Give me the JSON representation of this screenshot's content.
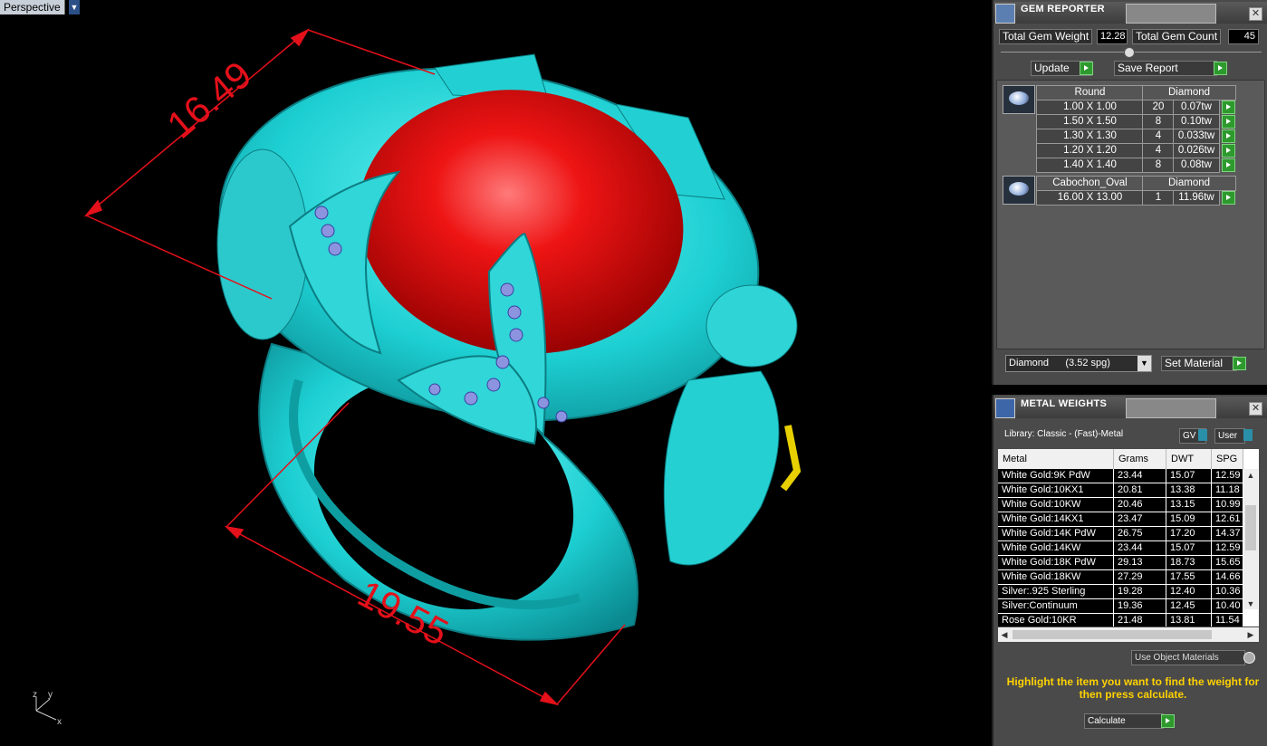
{
  "viewport": {
    "label": "Perspective",
    "dimensions": [
      "16.49",
      "19.55"
    ],
    "axis_labels": {
      "z": "z",
      "y": "y",
      "x": "x"
    }
  },
  "gem_reporter": {
    "title": "GEM REPORTER",
    "total_weight_label": "Total Gem Weight",
    "total_weight_value": "12.28",
    "total_count_label": "Total Gem Count",
    "total_count_value": "45",
    "update_label": "Update",
    "save_report_label": "Save Report",
    "groups": [
      {
        "shape": "Round",
        "material": "Diamond",
        "rows": [
          {
            "size": "1.00 X 1.00",
            "count": "20",
            "weight": "0.07tw"
          },
          {
            "size": "1.50 X 1.50",
            "count": "8",
            "weight": "0.10tw"
          },
          {
            "size": "1.30 X 1.30",
            "count": "4",
            "weight": "0.033tw"
          },
          {
            "size": "1.20 X 1.20",
            "count": "4",
            "weight": "0.026tw"
          },
          {
            "size": "1.40 X 1.40",
            "count": "8",
            "weight": "0.08tw"
          }
        ]
      },
      {
        "shape": "Cabochon_Oval",
        "material": "Diamond",
        "rows": [
          {
            "size": "16.00 X 13.00",
            "count": "1",
            "weight": "11.96tw"
          }
        ]
      }
    ],
    "material_select": "Diamond      (3.52 spg)",
    "set_material_label": "Set Material"
  },
  "metal_weights": {
    "title": "METAL WEIGHTS",
    "library": "Library: Classic - (Fast)-Metal",
    "gv_label": "GV",
    "user_label": "User",
    "columns": [
      "Metal",
      "Grams",
      "DWT",
      "SPG"
    ],
    "rows": [
      [
        "White Gold:9K PdW",
        "23.44",
        "15.07",
        "12.59"
      ],
      [
        "White Gold:10KX1",
        "20.81",
        "13.38",
        "11.18"
      ],
      [
        "White Gold:10KW",
        "20.46",
        "13.15",
        "10.99"
      ],
      [
        "White Gold:14KX1",
        "23.47",
        "15.09",
        "12.61"
      ],
      [
        "White Gold:14K PdW",
        "26.75",
        "17.20",
        "14.37"
      ],
      [
        "White Gold:14KW",
        "23.44",
        "15.07",
        "12.59"
      ],
      [
        "White Gold:18K PdW",
        "29.13",
        "18.73",
        "15.65"
      ],
      [
        "White Gold:18KW",
        "27.29",
        "17.55",
        "14.66"
      ],
      [
        "Silver:.925 Sterling",
        "19.28",
        "12.40",
        "10.36"
      ],
      [
        "Silver:Continuum",
        "19.36",
        "12.45",
        "10.40"
      ],
      [
        "Rose Gold:10KR",
        "21.48",
        "13.81",
        "11.54"
      ]
    ],
    "use_object_materials": "Use Object Materials",
    "hint": "Highlight the item you want to find the weight for then press calculate.",
    "calculate_label": "Calculate"
  },
  "colors": {
    "ring": "#1fd8d8",
    "gem": "#e01010",
    "dimension": "#e4101a",
    "hint": "#ffd200"
  }
}
